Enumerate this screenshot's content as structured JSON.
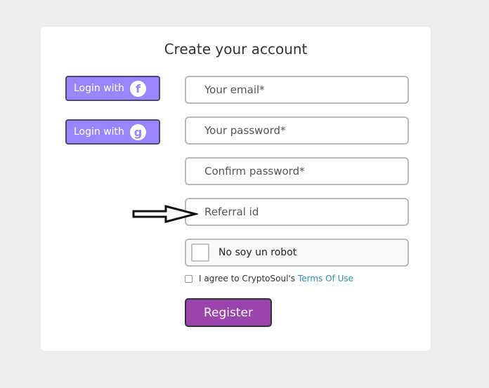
{
  "form": {
    "title": "Create your account",
    "social": [
      {
        "label": "Login with",
        "icon": "facebook-icon",
        "glyph": "f"
      },
      {
        "label": "Login with",
        "icon": "google-icon",
        "glyph": "g"
      }
    ],
    "fields": {
      "email_placeholder": "Your email*",
      "password_placeholder": "Your password*",
      "confirm_placeholder": "Confirm password*",
      "referral_placeholder": "Referral id"
    },
    "captcha_label": "No soy un robot",
    "agree_text": "I agree to CryptoSoul's",
    "terms_link": "Terms Of Use",
    "register_label": "Register"
  },
  "colors": {
    "social_button": "#9a85ff",
    "register_button": "#9b44ad",
    "link": "#2a8fb3"
  }
}
